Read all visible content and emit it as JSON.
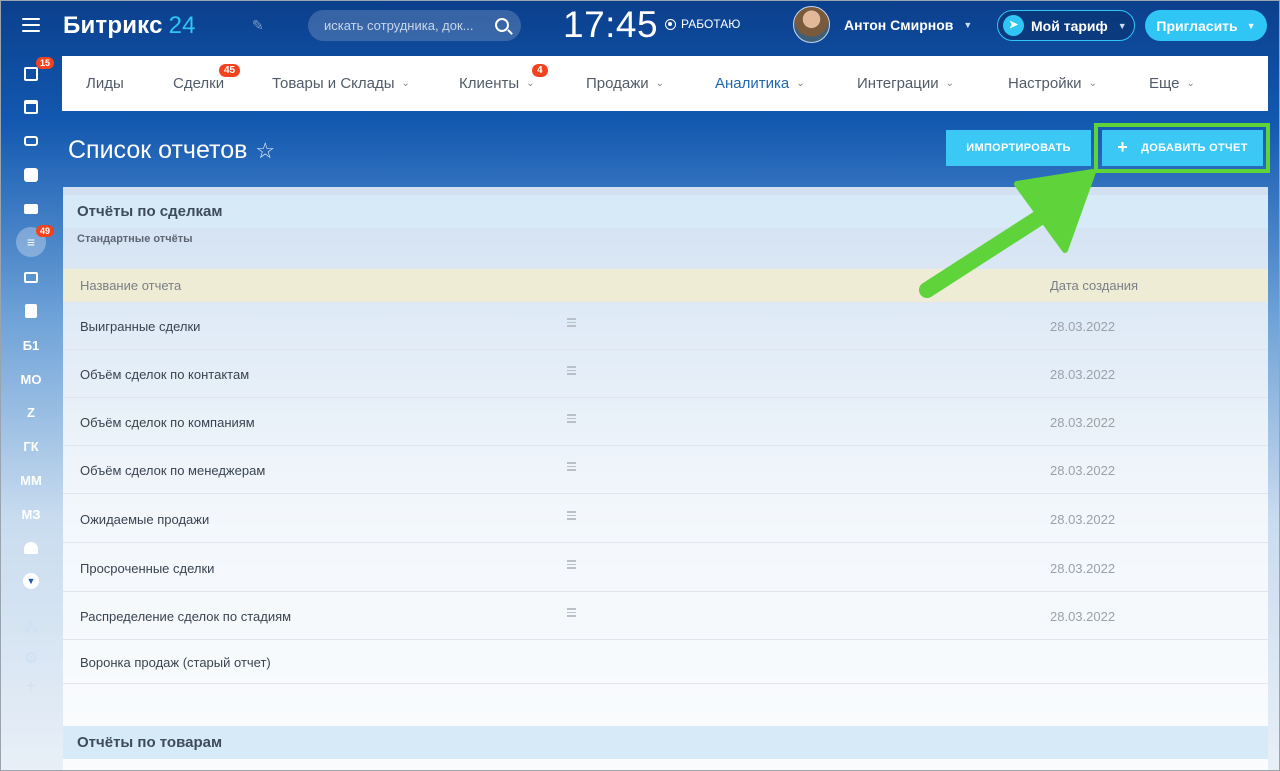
{
  "header": {
    "logo_main": "Битрикс",
    "logo_num": "24",
    "search_placeholder": "искать сотрудника, док...",
    "clock": "17:45",
    "work_status": "РАБОТАЮ",
    "user_name": "Антон Смирнов",
    "tariff_label": "Мой тариф",
    "invite_label": "Пригласить"
  },
  "leftbar": {
    "tasks_badge": "15",
    "crm_badge": "49",
    "text_items": [
      "Б1",
      "МО",
      "Z",
      "ГК",
      "ММ",
      "МЗ"
    ]
  },
  "nav": {
    "items": [
      {
        "label": "Лиды",
        "badge": ""
      },
      {
        "label": "Сделки",
        "badge": "45"
      },
      {
        "label": "Товары и Склады",
        "badge": ""
      },
      {
        "label": "Клиенты",
        "badge": "4"
      },
      {
        "label": "Продажи",
        "badge": ""
      },
      {
        "label": "Аналитика",
        "badge": ""
      },
      {
        "label": "Интеграции",
        "badge": ""
      },
      {
        "label": "Настройки",
        "badge": ""
      },
      {
        "label": "Еще",
        "badge": ""
      }
    ]
  },
  "page": {
    "title": "Список отчетов",
    "import_label": "ИМПОРТИРОВАТЬ",
    "add_label": "ДОБАВИТЬ ОТЧЕТ"
  },
  "sections": {
    "deals": {
      "title": "Отчёты по сделкам",
      "subtitle": "Стандартные отчёты",
      "col_name": "Название отчета",
      "col_date": "Дата создания",
      "rows": [
        {
          "name": "Выигранные сделки",
          "date": "28.03.2022"
        },
        {
          "name": "Объём сделок по контактам",
          "date": "28.03.2022"
        },
        {
          "name": "Объём сделок по компаниям",
          "date": "28.03.2022"
        },
        {
          "name": "Объём сделок по менеджерам",
          "date": "28.03.2022"
        },
        {
          "name": "Ожидаемые продажи",
          "date": "28.03.2022"
        },
        {
          "name": "Просроченные сделки",
          "date": "28.03.2022"
        },
        {
          "name": "Распределение сделок по стадиям",
          "date": "28.03.2022"
        },
        {
          "name": "Воронка продаж (старый отчет)",
          "date": ""
        }
      ]
    },
    "products": {
      "title": "Отчёты по товарам"
    }
  },
  "colors": {
    "accent": "#3bc8f5",
    "badge": "#f2421e",
    "highlight": "#5ed43a",
    "active_nav": "#2067b0"
  }
}
